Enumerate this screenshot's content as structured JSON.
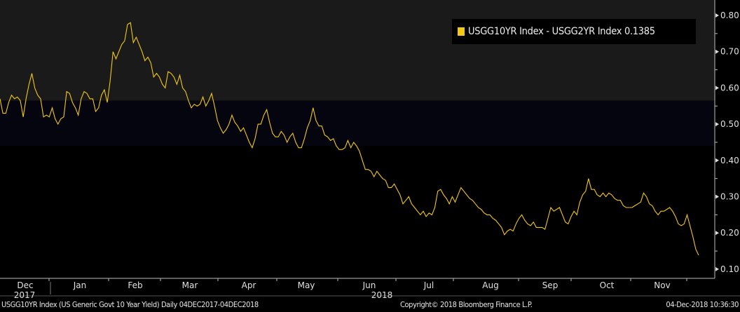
{
  "chart_data": {
    "type": "line",
    "title": "",
    "series": [
      {
        "name": "USGG10YR Index - USGG2YR Index",
        "last_value": "0.1385",
        "color": "#f2c811",
        "values": [
          0.57,
          0.53,
          0.53,
          0.56,
          0.58,
          0.57,
          0.575,
          0.565,
          0.52,
          0.57,
          0.61,
          0.64,
          0.6,
          0.58,
          0.57,
          0.52,
          0.525,
          0.52,
          0.545,
          0.515,
          0.5,
          0.515,
          0.52,
          0.59,
          0.585,
          0.56,
          0.545,
          0.525,
          0.57,
          0.59,
          0.585,
          0.57,
          0.57,
          0.535,
          0.545,
          0.58,
          0.595,
          0.56,
          0.62,
          0.7,
          0.68,
          0.7,
          0.72,
          0.73,
          0.775,
          0.78,
          0.725,
          0.74,
          0.72,
          0.7,
          0.675,
          0.685,
          0.67,
          0.63,
          0.64,
          0.63,
          0.61,
          0.6,
          0.645,
          0.64,
          0.63,
          0.61,
          0.635,
          0.6,
          0.59,
          0.565,
          0.545,
          0.555,
          0.55,
          0.555,
          0.575,
          0.55,
          0.565,
          0.585,
          0.55,
          0.51,
          0.49,
          0.475,
          0.485,
          0.5,
          0.525,
          0.505,
          0.495,
          0.48,
          0.49,
          0.47,
          0.45,
          0.435,
          0.46,
          0.5,
          0.5,
          0.525,
          0.54,
          0.505,
          0.475,
          0.465,
          0.465,
          0.48,
          0.47,
          0.45,
          0.465,
          0.475,
          0.45,
          0.435,
          0.435,
          0.46,
          0.49,
          0.51,
          0.545,
          0.51,
          0.495,
          0.495,
          0.47,
          0.465,
          0.455,
          0.46,
          0.44,
          0.43,
          0.43,
          0.435,
          0.455,
          0.435,
          0.45,
          0.44,
          0.425,
          0.4,
          0.375,
          0.375,
          0.37,
          0.355,
          0.37,
          0.36,
          0.35,
          0.345,
          0.325,
          0.325,
          0.335,
          0.32,
          0.305,
          0.28,
          0.29,
          0.3,
          0.28,
          0.27,
          0.26,
          0.25,
          0.26,
          0.245,
          0.255,
          0.25,
          0.27,
          0.315,
          0.32,
          0.305,
          0.295,
          0.28,
          0.3,
          0.285,
          0.305,
          0.325,
          0.315,
          0.305,
          0.295,
          0.29,
          0.28,
          0.27,
          0.265,
          0.255,
          0.25,
          0.25,
          0.24,
          0.235,
          0.225,
          0.215,
          0.195,
          0.205,
          0.21,
          0.205,
          0.225,
          0.24,
          0.25,
          0.235,
          0.225,
          0.22,
          0.23,
          0.215,
          0.215,
          0.215,
          0.21,
          0.24,
          0.27,
          0.26,
          0.265,
          0.27,
          0.25,
          0.23,
          0.225,
          0.245,
          0.26,
          0.25,
          0.285,
          0.305,
          0.315,
          0.35,
          0.32,
          0.32,
          0.305,
          0.3,
          0.31,
          0.3,
          0.31,
          0.305,
          0.295,
          0.29,
          0.29,
          0.275,
          0.27,
          0.27,
          0.27,
          0.275,
          0.28,
          0.285,
          0.31,
          0.3,
          0.28,
          0.275,
          0.26,
          0.25,
          0.26,
          0.26,
          0.265,
          0.27,
          0.26,
          0.245,
          0.225,
          0.22,
          0.225,
          0.25,
          0.22,
          0.19,
          0.155,
          0.1385
        ]
      }
    ],
    "x_start": "04DEC2017",
    "x_end": "04DEC2018",
    "x_tick_labels": [
      "Dec",
      "Jan",
      "Feb",
      "Mar",
      "Apr",
      "May",
      "Jun",
      "Jul",
      "Aug",
      "Sep",
      "Oct",
      "Nov"
    ],
    "x_year_labels": [
      "2017",
      "2018"
    ],
    "y_tick_labels": [
      "0.80",
      "0.70",
      "0.60",
      "0.50",
      "0.40",
      "0.30",
      "0.20",
      "0.10"
    ],
    "y_ticks": [
      0.8,
      0.7,
      0.6,
      0.5,
      0.4,
      0.3,
      0.2,
      0.1
    ],
    "ylim": [
      0.08,
      0.84
    ],
    "shaded_band": [
      0.44,
      0.565
    ],
    "legend_placement": "top-right",
    "grid": false
  },
  "legend": {
    "label": "USGG10YR Index - USGG2YR Index 0.1385"
  },
  "footer": {
    "description": "USGG10YR Index (US Generic Govt 10 Year Yield)  Daily 04DEC2017-04DEC2018",
    "copyright": "Copyright© 2018 Bloomberg Finance L.P.",
    "timestamp": "04-Dec-2018 10:36:30"
  }
}
